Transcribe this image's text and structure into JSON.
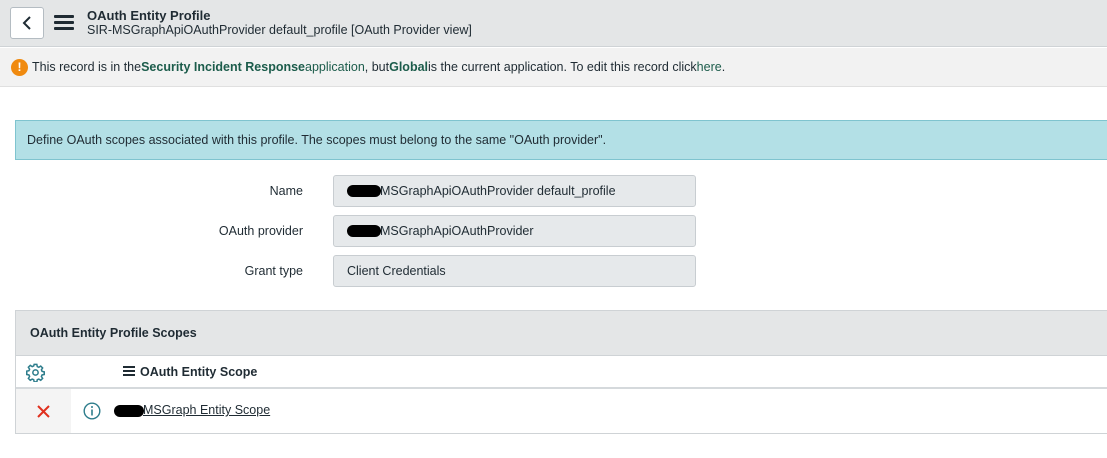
{
  "header": {
    "title": "OAuth Entity Profile",
    "subtitle": "SIR-MSGraphApiOAuthProvider default_profile [OAuth Provider view]"
  },
  "notice": {
    "prefix": "This record is in the ",
    "app_name": "Security Incident Response",
    "mid1": " application",
    "mid2": ", but ",
    "current_app": "Global",
    "mid3": " is the current application. To edit this record click ",
    "link": "here",
    "suffix": ".",
    "icon": "warning-icon",
    "icon_glyph": "!"
  },
  "info": {
    "text": "Define OAuth scopes associated with this profile. The scopes must belong to the same \"OAuth provider\"."
  },
  "form": {
    "name_label": "Name",
    "name_value": "MSGraphApiOAuthProvider default_profile",
    "provider_label": "OAuth provider",
    "provider_value": "MSGraphApiOAuthProvider",
    "grant_label": "Grant type",
    "grant_value": "Client Credentials"
  },
  "related_list": {
    "title": "OAuth Entity Profile Scopes",
    "column": "OAuth Entity Scope",
    "rows": [
      {
        "value": "MSGraph Entity Scope"
      }
    ]
  },
  "colors": {
    "warning": "#f08a0f",
    "accent_green": "#1c5c4b",
    "info_bg": "#b3e0e6",
    "delete_red": "#e0301e"
  }
}
